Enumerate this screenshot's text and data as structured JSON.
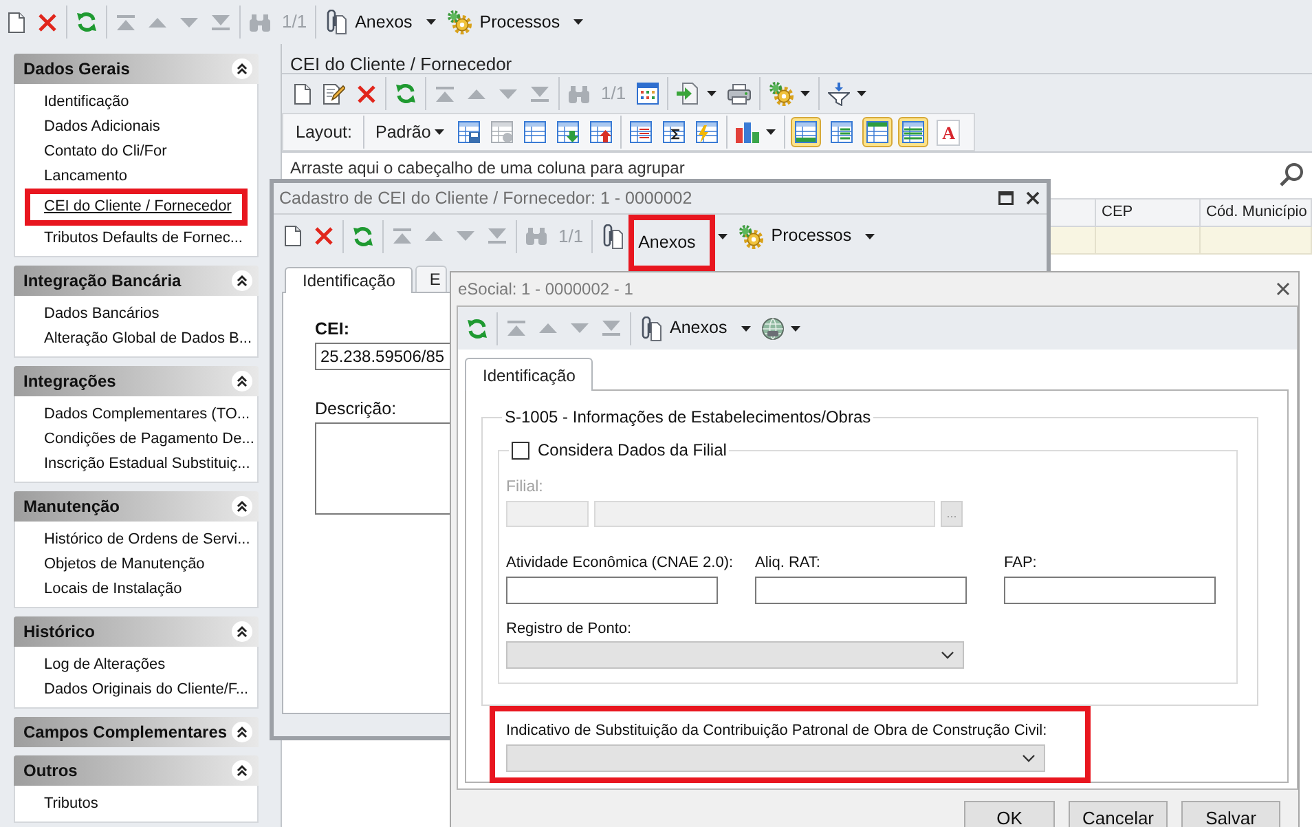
{
  "toolbar": {
    "items": [
      {
        "kind": "new",
        "disabled": false
      },
      {
        "kind": "delete",
        "disabled": false
      },
      {
        "kind": "separator"
      },
      {
        "kind": "refresh",
        "disabled": false
      },
      {
        "kind": "separator"
      },
      {
        "kind": "first",
        "disabled": true
      },
      {
        "kind": "previous",
        "disabled": true
      },
      {
        "kind": "next",
        "disabled": true
      },
      {
        "kind": "last",
        "disabled": true
      },
      {
        "kind": "separator"
      },
      {
        "kind": "find",
        "disabled": true
      },
      {
        "kind": "counter",
        "text": "1/1",
        "disabled": true
      },
      {
        "kind": "separator"
      },
      {
        "kind": "attachments",
        "label": "Anexos",
        "highlighted": false
      },
      {
        "kind": "processes",
        "label": "Processos",
        "highlighted": false
      }
    ]
  },
  "sidebar": {
    "groups": [
      {
        "title": "Dados Gerais",
        "items": [
          {
            "label": "Identificação",
            "selected": false,
            "highlighted": false
          },
          {
            "label": "Dados Adicionais",
            "selected": false,
            "highlighted": false
          },
          {
            "label": "Contato do Cli/For",
            "selected": false,
            "highlighted": false
          },
          {
            "label": "Lancamento",
            "selected": false,
            "highlighted": false
          },
          {
            "label": "CEI do Cliente / Fornecedor",
            "selected": true,
            "highlighted": true
          },
          {
            "label": "Tributos Defaults de Fornec...",
            "selected": false,
            "highlighted": false
          }
        ]
      },
      {
        "title": "Integração Bancária",
        "items": [
          {
            "label": "Dados Bancários",
            "selected": false,
            "highlighted": false
          },
          {
            "label": "Alteração Global de Dados B...",
            "selected": false,
            "highlighted": false
          }
        ]
      },
      {
        "title": "Integrações",
        "items": [
          {
            "label": "Dados Complementares (TO...",
            "selected": false,
            "highlighted": false
          },
          {
            "label": "Condições de Pagamento De...",
            "selected": false,
            "highlighted": false
          },
          {
            "label": "Inscrição Estadual Substituiç...",
            "selected": false,
            "highlighted": false
          }
        ]
      },
      {
        "title": "Manutenção",
        "items": [
          {
            "label": "Histórico de Ordens de Servi...",
            "selected": false,
            "highlighted": false
          },
          {
            "label": "Objetos de Manutenção",
            "selected": false,
            "highlighted": false
          },
          {
            "label": "Locais de Instalação",
            "selected": false,
            "highlighted": false
          }
        ]
      },
      {
        "title": "Histórico",
        "items": [
          {
            "label": "Log de Alterações",
            "selected": false,
            "highlighted": false
          },
          {
            "label": "Dados Originais do Cliente/F...",
            "selected": false,
            "highlighted": false
          }
        ]
      },
      {
        "title": "Campos Complementares"
      },
      {
        "title": "Outros",
        "items": [
          {
            "label": "Tributos",
            "selected": false,
            "highlighted": false
          }
        ]
      }
    ]
  },
  "panel": {
    "title": "CEI do Cliente / Fornecedor",
    "toolbar": {
      "items": [
        {
          "kind": "new",
          "disabled": false
        },
        {
          "kind": "edit",
          "disabled": false
        },
        {
          "kind": "delete",
          "disabled": false
        },
        {
          "kind": "separator"
        },
        {
          "kind": "refresh",
          "disabled": false
        },
        {
          "kind": "separator"
        },
        {
          "kind": "first",
          "disabled": true
        },
        {
          "kind": "previous",
          "disabled": true
        },
        {
          "kind": "next",
          "disabled": true
        },
        {
          "kind": "last",
          "disabled": true
        },
        {
          "kind": "separator"
        },
        {
          "kind": "find",
          "disabled": true
        },
        {
          "kind": "counter",
          "text": "1/1",
          "disabled": true
        },
        {
          "kind": "grid",
          "disabled": false
        },
        {
          "kind": "separator"
        },
        {
          "kind": "export",
          "disabled": false
        },
        {
          "kind": "print",
          "disabled": false
        },
        {
          "kind": "separator"
        },
        {
          "kind": "automation",
          "disabled": false
        },
        {
          "kind": "separator"
        },
        {
          "kind": "filter",
          "disabled": false
        }
      ]
    },
    "layout_bar": {
      "items": [
        {
          "kind": "label",
          "text": "Layout:"
        },
        {
          "kind": "separator"
        },
        {
          "kind": "dropdown",
          "text": "Padrão"
        },
        {
          "kind": "store",
          "disabled": false
        },
        {
          "kind": "discard",
          "disabled": true
        },
        {
          "kind": "sheet",
          "disabled": false
        },
        {
          "kind": "download",
          "disabled": false
        },
        {
          "kind": "upload",
          "disabled": false
        },
        {
          "kind": "separator"
        },
        {
          "kind": "columns",
          "disabled": false
        },
        {
          "kind": "totals",
          "disabled": false
        },
        {
          "kind": "format",
          "disabled": false
        },
        {
          "kind": "separator"
        },
        {
          "kind": "chart",
          "disabled": false
        },
        {
          "kind": "separator"
        },
        {
          "kind": "toggle",
          "on": true
        },
        {
          "kind": "toggle",
          "on": false
        },
        {
          "kind": "toggle",
          "on": true
        },
        {
          "kind": "toggle",
          "on": true
        },
        {
          "kind": "fontcolor",
          "glyph": "A"
        }
      ]
    },
    "group_hint": "Arraste aqui o cabeçalho de uma coluna para agrupar",
    "table": {
      "columns": [
        "CEP",
        "Cód. Município"
      ]
    }
  },
  "cadastro_window": {
    "title": "Cadastro de CEI do Cliente / Fornecedor: 1 - 0000002",
    "toolbar": {
      "items": [
        {
          "kind": "new",
          "disabled": false
        },
        {
          "kind": "delete",
          "disabled": false
        },
        {
          "kind": "separator"
        },
        {
          "kind": "refresh",
          "disabled": false
        },
        {
          "kind": "separator"
        },
        {
          "kind": "first",
          "disabled": true
        },
        {
          "kind": "previous",
          "disabled": true
        },
        {
          "kind": "next",
          "disabled": true
        },
        {
          "kind": "last",
          "disabled": true
        },
        {
          "kind": "separator"
        },
        {
          "kind": "find",
          "disabled": true
        },
        {
          "kind": "counter",
          "text": "1/1",
          "disabled": true
        },
        {
          "kind": "separator"
        },
        {
          "kind": "attachments",
          "label": "Anexos",
          "highlighted": true
        },
        {
          "kind": "processes",
          "label": "Processos",
          "highlighted": false
        }
      ]
    },
    "tabs": [
      {
        "label": "Identificação",
        "selected": true
      },
      {
        "label": "E",
        "selected": false
      }
    ],
    "fields": [
      {
        "kind": "text",
        "label": "CEI:",
        "required": true,
        "value": "25.238.59506/85"
      },
      {
        "kind": "textarea",
        "label": "Descrição:",
        "required": false
      }
    ]
  },
  "esocial_window": {
    "title": "eSocial: 1 - 0000002 - 1",
    "toolbar": {
      "items": [
        {
          "kind": "refresh",
          "disabled": false
        },
        {
          "kind": "separator"
        },
        {
          "kind": "first",
          "disabled": true
        },
        {
          "kind": "previous",
          "disabled": true
        },
        {
          "kind": "next",
          "disabled": true
        },
        {
          "kind": "last",
          "disabled": true
        },
        {
          "kind": "separator"
        },
        {
          "kind": "attachments",
          "label": "Anexos",
          "highlighted": false
        },
        {
          "kind": "globe",
          "disabled": false
        }
      ]
    },
    "tabs": [
      {
        "label": "Identificação",
        "selected": true
      }
    ],
    "section": {
      "title": "S-1005 - Informações de Estabelecimentos/Obras",
      "branch_group": {
        "checkbox": {
          "label": "Considera Dados da Filial",
          "checked": false
        },
        "branch": {
          "label": "Filial:",
          "disabled": true,
          "button": "..."
        },
        "fields": [
          {
            "label": "Atividade Econômica (CNAE 2.0):"
          },
          {
            "label": "Aliq. RAT:"
          },
          {
            "label": "FAP:"
          }
        ],
        "time_clock": {
          "label": "Registro de Ponto:"
        }
      }
    },
    "substitution": {
      "label": "Indicativo de Substituição da Contribuição Patronal de Obra de Construção Civil:",
      "highlighted": true
    },
    "buttons": [
      {
        "label": "OK"
      },
      {
        "label": "Cancelar"
      },
      {
        "label": "Salvar"
      }
    ]
  }
}
